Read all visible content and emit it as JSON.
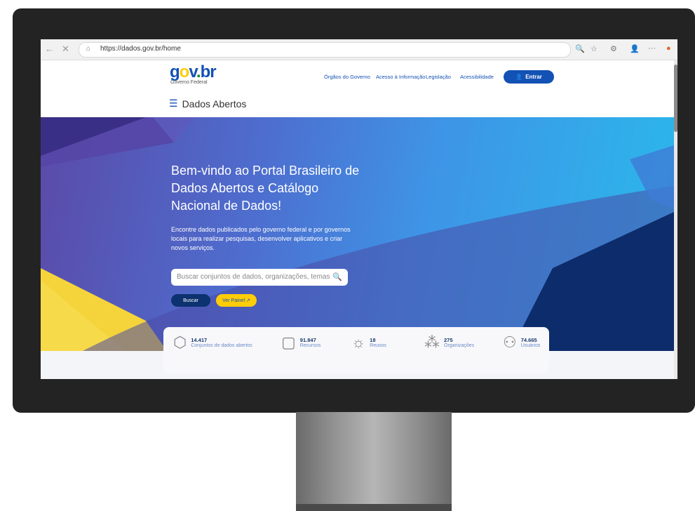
{
  "browser": {
    "url": "https://dados.gov.br/home",
    "back_icon": "←",
    "close_icon": "✕",
    "lock_icon": "🔒",
    "toolbar_icons": [
      "🔍",
      "☆",
      "⚙",
      "👤",
      "···"
    ]
  },
  "header": {
    "logo_text": "gov.br",
    "logo_subtitle": "Governo Federal",
    "nav": [
      "Órgãos do Governo",
      "Acesso à Informação",
      "Legislação",
      "Acessibilidade"
    ],
    "login_label": "Entrar",
    "menu_title": "Dados Abertos"
  },
  "hero": {
    "title": "Bem-vindo ao Portal Brasileiro de Dados Abertos e Catálogo Nacional de Dados!",
    "description": "Encontre dados publicados pelo governo federal e por governos locais para realizar pesquisas, desenvolver aplicativos e criar novos serviços.",
    "search_placeholder": "Buscar conjuntos de dados, organizações, temas",
    "search_button": "Buscar",
    "panel_button": "Ver Painel"
  },
  "stats": [
    {
      "icon": "cube-icon",
      "value": "14.417",
      "label": "Conjuntos de dados abertos"
    },
    {
      "icon": "document-icon",
      "value": "91.847",
      "label": "Recursos"
    },
    {
      "icon": "lightbulb-icon",
      "value": "18",
      "label": "Reusos"
    },
    {
      "icon": "organization-icon",
      "value": "275",
      "label": "Organizações"
    },
    {
      "icon": "users-icon",
      "value": "74.665",
      "label": "Usuários"
    }
  ],
  "colors": {
    "brand_blue": "#1351b4",
    "navy": "#0c326f",
    "yellow": "#ffcd07",
    "hero_light": "#2ab9ec"
  }
}
